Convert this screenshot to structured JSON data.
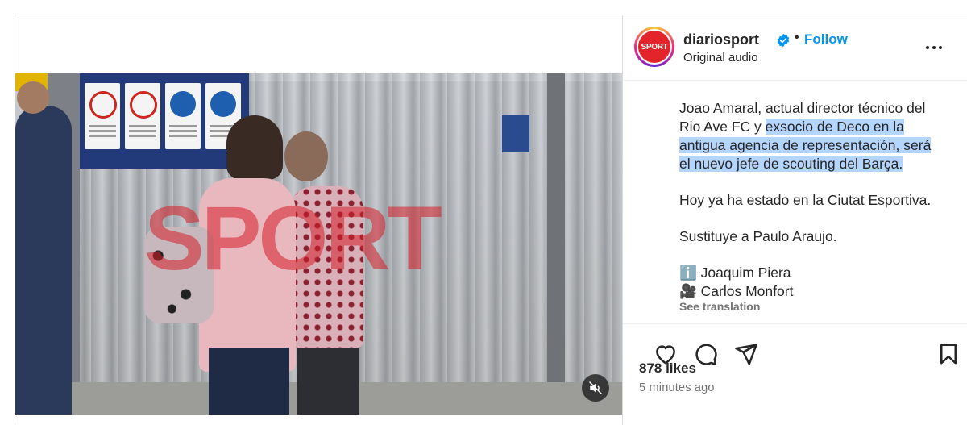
{
  "post": {
    "username": "diariosport",
    "avatar_text": "SPORT",
    "follow_label": "Follow",
    "separator": "•",
    "audio_label": "Original audio",
    "watermark": "SPORT",
    "caption": {
      "p1_line1": "Joao Amaral, actual director técnico del",
      "p1_line2_plain": "Rio Ave FC y ",
      "p1_line2_highlight": "exsocio de Deco en la",
      "p1_line3": "antigua agencia de representación, será",
      "p1_line4": "el nuevo jefe de scouting del Barça.",
      "p2": "Hoy ya ha estado en la Ciutat Esportiva.",
      "p3": "Sustituye a Paulo Araujo.",
      "credit1_icon": "ℹ️",
      "credit1": "Joaquim Piera",
      "credit2_icon": "🎥",
      "credit2": "Carlos Monfort"
    },
    "see_translation": "See translation",
    "likes": "878 likes",
    "time": "5 minutes ago"
  },
  "icons": {
    "verified": "verified-badge-icon",
    "more": "more-options-icon",
    "like": "heart-icon",
    "comment": "comment-icon",
    "share": "paper-plane-icon",
    "save": "bookmark-icon",
    "mute": "speaker-muted-icon"
  },
  "colors": {
    "accent": "#0095f6",
    "highlight": "#b4d5fe",
    "brand_red": "#e3242b",
    "muted_text": "#737373"
  }
}
